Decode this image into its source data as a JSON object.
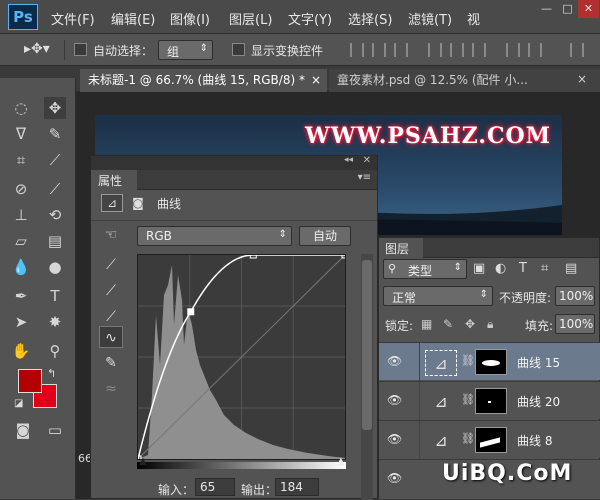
{
  "app": {
    "logo": "Ps"
  },
  "menu": [
    "文件(F)",
    "编辑(E)",
    "图像(I)",
    "图层(L)",
    "文字(Y)",
    "选择(S)",
    "滤镜(T)",
    "视"
  ],
  "window_buttons": [
    "—",
    "□",
    "✕"
  ],
  "options": {
    "auto_select_label": "自动选择：",
    "auto_select_value": "组",
    "show_transform_label": "显示变换控件"
  },
  "tabs": [
    {
      "label": "未标题-1 @ 66.7% (曲线 15, RGB/8) *",
      "close": "×",
      "active": true
    },
    {
      "label": "童夜素材.psd @ 12.5% (配件 小...",
      "close": "×",
      "active": false
    }
  ],
  "document": {
    "watermark": "WWW.PSAHZ.COM"
  },
  "status": {
    "zoom_partial": "66"
  },
  "properties": {
    "title": "属性",
    "adj_name": "曲线",
    "channel": "RGB",
    "auto_label": "自动",
    "input_label": "输入：",
    "input_value": "65",
    "output_label": "输出：",
    "output_value": "184"
  },
  "curve": {
    "input_max": 255,
    "points": [
      [
        0,
        0
      ],
      [
        65,
        184
      ],
      [
        142,
        255
      ],
      [
        255,
        255
      ]
    ]
  },
  "layers": {
    "title": "图层",
    "filter_label": "类型",
    "blend_mode": "正常",
    "opacity_label": "不透明度:",
    "opacity_value": "100%",
    "lock_label": "锁定:",
    "fill_label": "填充:",
    "fill_value": "100%",
    "items": [
      {
        "name": "曲线 15",
        "selected": true
      },
      {
        "name": "曲线 20",
        "selected": false
      },
      {
        "name": "曲线 8",
        "selected": false
      }
    ]
  },
  "brand": "UiBQ.CoM",
  "colors": {
    "foreground": "#b30000",
    "background": "#e0001a",
    "accent_blue": "#5fb2f2"
  }
}
